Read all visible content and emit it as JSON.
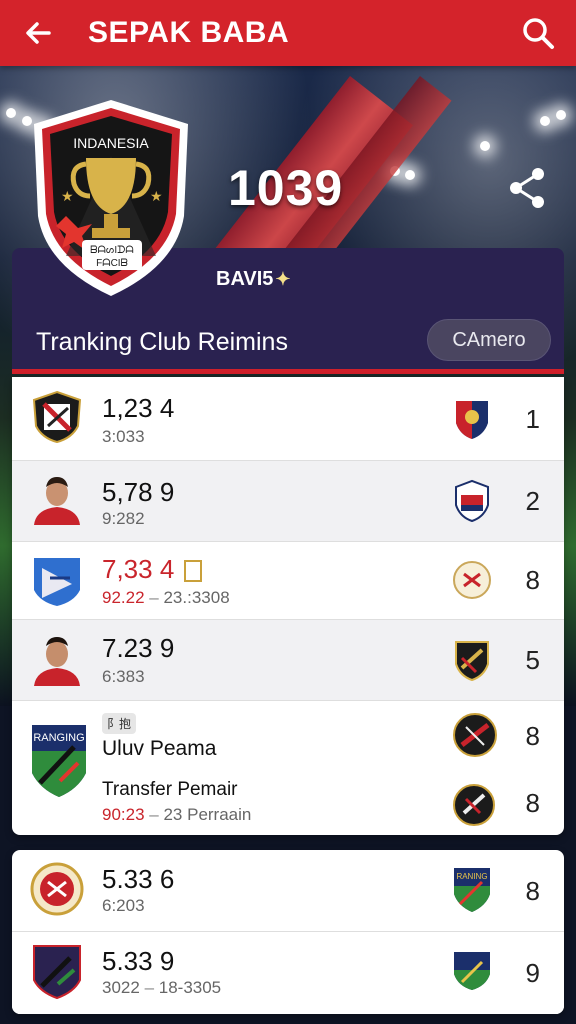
{
  "app": {
    "title": "SEPAK BABA"
  },
  "hero": {
    "badge_title": "INDANESIA",
    "badge_caption": "ᗷᗩᔕIᗪᗩ",
    "badge_subcaption": "FᗩCIᗷ",
    "score": "1039"
  },
  "panel": {
    "subtitle": "BAVI5",
    "heading": "Tranking Club Reimins",
    "filter_button": "CAmero"
  },
  "rows": [
    {
      "main": "1,23 4",
      "sub": "3:033",
      "sub_extra": "",
      "rank": "1"
    },
    {
      "main": "5,78 9",
      "sub": "9:282",
      "sub_extra": "",
      "rank": "2"
    },
    {
      "main": "7,33 4",
      "sub": "92.22",
      "sub_extra": "23.:3308",
      "rank": "8"
    },
    {
      "main": "7.23 9",
      "sub": "6:383",
      "sub_extra": "",
      "rank": "5"
    }
  ],
  "transfer": {
    "tag": "阝抱",
    "badge_label": "RANGING",
    "player": "Uluv Peama",
    "title": "Transfer Pemair",
    "sub_red": "90:23",
    "sub_extra": "23 Perraain",
    "rank_top": "8",
    "rank_bottom": "8"
  },
  "rows2": [
    {
      "main": "5.33 6",
      "sub": "6:203",
      "sub_extra": "",
      "rank": "8",
      "badge_label": "RANING"
    },
    {
      "main": "5.33 9",
      "sub": "3022",
      "sub_extra": "18-3305",
      "rank": "9"
    }
  ],
  "colors": {
    "accent": "#d4232b",
    "panel": "#2a2250",
    "text_red": "#c9252c"
  }
}
